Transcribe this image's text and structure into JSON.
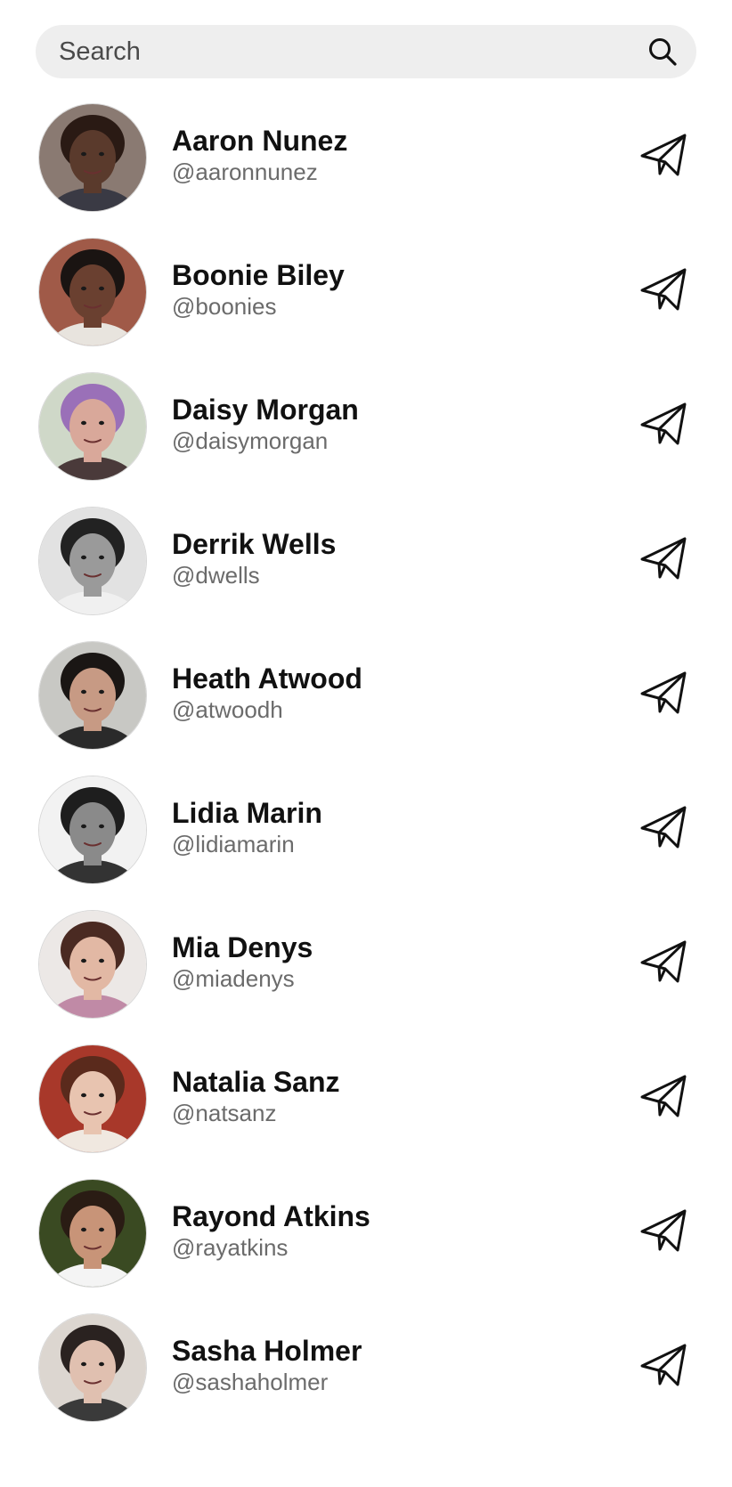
{
  "search": {
    "placeholder": "Search"
  },
  "icons": {
    "search": "search-icon",
    "send": "paper-plane-icon"
  },
  "contacts": [
    {
      "name": "Aaron Nunez",
      "handle": "@aaronnunez",
      "avatar_colors": {
        "bg": "#8a7a72",
        "skin": "#5a3a2c",
        "hair": "#2a1a14",
        "shirt": "#3a3a44"
      }
    },
    {
      "name": "Boonie Biley",
      "handle": "@boonies",
      "avatar_colors": {
        "bg": "#a05a48",
        "skin": "#6a4030",
        "hair": "#1a1412",
        "shirt": "#e8e4de"
      }
    },
    {
      "name": "Daisy Morgan",
      "handle": "@daisymorgan",
      "avatar_colors": {
        "bg": "#cfd8c8",
        "skin": "#d9a89a",
        "hair": "#9a70b8",
        "shirt": "#4a3a3a"
      }
    },
    {
      "name": "Derrik Wells",
      "handle": "@dwells",
      "avatar_colors": {
        "bg": "#e2e2e2",
        "skin": "#9a9a9a",
        "hair": "#222222",
        "shirt": "#f0f0f0"
      }
    },
    {
      "name": "Heath Atwood",
      "handle": "@atwoodh",
      "avatar_colors": {
        "bg": "#c8c8c4",
        "skin": "#c79a84",
        "hair": "#1a1614",
        "shirt": "#2a2a2a"
      }
    },
    {
      "name": "Lidia Marin",
      "handle": "@lidiamarin",
      "avatar_colors": {
        "bg": "#f2f2f2",
        "skin": "#8a8a8a",
        "hair": "#1e1e1e",
        "shirt": "#333333"
      }
    },
    {
      "name": "Mia Denys",
      "handle": "@miadenys",
      "avatar_colors": {
        "bg": "#ece8e6",
        "skin": "#e2b8a4",
        "hair": "#4a2a22",
        "shirt": "#c08aa6"
      }
    },
    {
      "name": "Natalia Sanz",
      "handle": "@natsanz",
      "avatar_colors": {
        "bg": "#a8382a",
        "skin": "#e8c4b0",
        "hair": "#5a2a1c",
        "shirt": "#f0e8e0"
      }
    },
    {
      "name": "Rayond Atkins",
      "handle": "@rayatkins",
      "avatar_colors": {
        "bg": "#3a4a22",
        "skin": "#c89478",
        "hair": "#2a1c14",
        "shirt": "#f4f4f4"
      }
    },
    {
      "name": "Sasha Holmer",
      "handle": "@sashaholmer",
      "avatar_colors": {
        "bg": "#dcd6d0",
        "skin": "#e0c0b0",
        "hair": "#2a2220",
        "shirt": "#3a3a3a"
      }
    }
  ]
}
